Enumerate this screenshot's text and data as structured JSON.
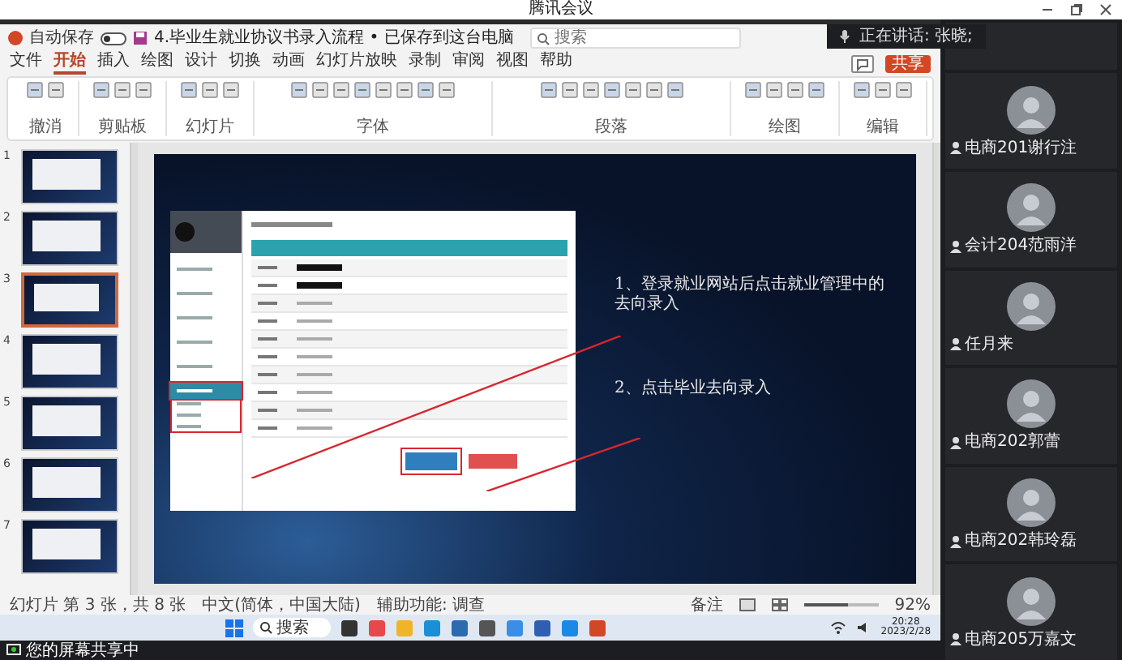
{
  "app": {
    "title": "腾讯会议"
  },
  "speaking": "正在讲话: 张晓;",
  "ppt": {
    "autosave_label": "自动保存",
    "autosave_on": false,
    "doc_title": "4.毕业生就业协议书录入流程 • 已保存到这台电脑",
    "search_placeholder": "搜索",
    "menu_tabs": [
      {
        "label": "文件",
        "selected": false
      },
      {
        "label": "开始",
        "selected": true
      },
      {
        "label": "插入",
        "selected": false
      },
      {
        "label": "绘图",
        "selected": false
      },
      {
        "label": "设计",
        "selected": false
      },
      {
        "label": "切换",
        "selected": false
      },
      {
        "label": "动画",
        "selected": false
      },
      {
        "label": "幻灯片放映",
        "selected": false
      },
      {
        "label": "录制",
        "selected": false
      },
      {
        "label": "审阅",
        "selected": false
      },
      {
        "label": "视图",
        "selected": false
      },
      {
        "label": "帮助",
        "selected": false
      }
    ],
    "share_button": "共享",
    "ribbon_groups": [
      {
        "label": "撤消"
      },
      {
        "label": "剪贴板"
      },
      {
        "label": "幻灯片"
      },
      {
        "label": "字体"
      },
      {
        "label": "段落"
      },
      {
        "label": "绘图"
      },
      {
        "label": "编辑"
      }
    ],
    "thumbnails": [
      {
        "number": "1",
        "selected": false
      },
      {
        "number": "2",
        "selected": false
      },
      {
        "number": "3",
        "selected": true
      },
      {
        "number": "4",
        "selected": false
      },
      {
        "number": "5",
        "selected": false
      },
      {
        "number": "6",
        "selected": false
      },
      {
        "number": "7",
        "selected": false
      }
    ],
    "slide": {
      "web_sidebar": [
        {
          "selected": false
        },
        {
          "selected": false
        },
        {
          "selected": false
        },
        {
          "selected": false
        },
        {
          "selected": false
        },
        {
          "selected": true
        }
      ],
      "web_rows": [
        {
          "redacted": true
        },
        {
          "redacted": true
        },
        {
          "redacted": false
        },
        {
          "redacted": false
        },
        {
          "redacted": false
        },
        {
          "redacted": false
        },
        {
          "redacted": false
        },
        {
          "redacted": false
        },
        {
          "redacted": false
        },
        {
          "redacted": false
        }
      ],
      "web_buttons": [
        {
          "kind": "primary",
          "highlighted": true
        },
        {
          "kind": "danger",
          "highlighted": false
        }
      ],
      "notes": [
        "1、登录就业网站后点击就业管理中的去向录入",
        "2、点击毕业去向录入"
      ]
    },
    "status": {
      "slide_info": "幻灯片 第 3 张，共 8 张",
      "language": "中文(简体，中国大陆)",
      "accessibility": "辅助功能: 调查",
      "notes_button": "备注",
      "level": 0.6,
      "zoom": "92%"
    }
  },
  "taskbar": {
    "search_placeholder": "搜索",
    "apps": [
      {
        "color": "#333333"
      },
      {
        "color": "#e8474c"
      },
      {
        "color": "#f0b429"
      },
      {
        "color": "#1a8fd6"
      },
      {
        "color": "#2b6cb0"
      },
      {
        "color": "#555555"
      },
      {
        "color": "#3a8ee6"
      },
      {
        "color": "#2f5fb3"
      },
      {
        "color": "#1e88e5"
      },
      {
        "color": "#d24726"
      }
    ],
    "time": "20:28",
    "date": "2023/2/28"
  },
  "participants": [
    {
      "name": "电商201谢行注"
    },
    {
      "name": "会计204范雨洋"
    },
    {
      "name": "任月来"
    },
    {
      "name": "电商202郭蕾"
    },
    {
      "name": "电商202韩玲磊"
    },
    {
      "name": "电商205万嘉文"
    }
  ],
  "share_notice": "您的屏幕共享中"
}
